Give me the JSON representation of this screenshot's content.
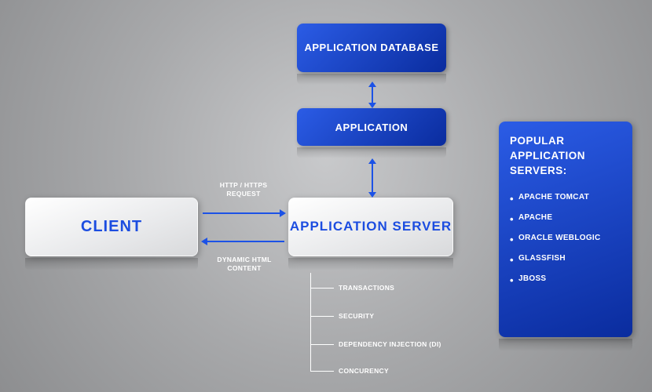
{
  "nodes": {
    "database": "APPLICATION DATABASE",
    "application": "APPLICATION",
    "appServer": "APPLICATION SERVER",
    "client": "CLIENT"
  },
  "arrows": {
    "request": "HTTP / HTTPS REQUEST",
    "response": "DYNAMIC HTML CONTENT"
  },
  "features": {
    "f1": "TRANSACTIONS",
    "f2": "SECURITY",
    "f3": "DEPENDENCY INJECTION (DI)",
    "f4": "CONCURENCY"
  },
  "sidebar": {
    "title": "POPULAR APPLICATION SERVERS:",
    "items": {
      "i0": "APACHE TOMCAT",
      "i1": "APACHE",
      "i2": "ORACLE WEBLOGIC",
      "i3": "GLASSFISH",
      "i4": "JBOSS"
    }
  }
}
